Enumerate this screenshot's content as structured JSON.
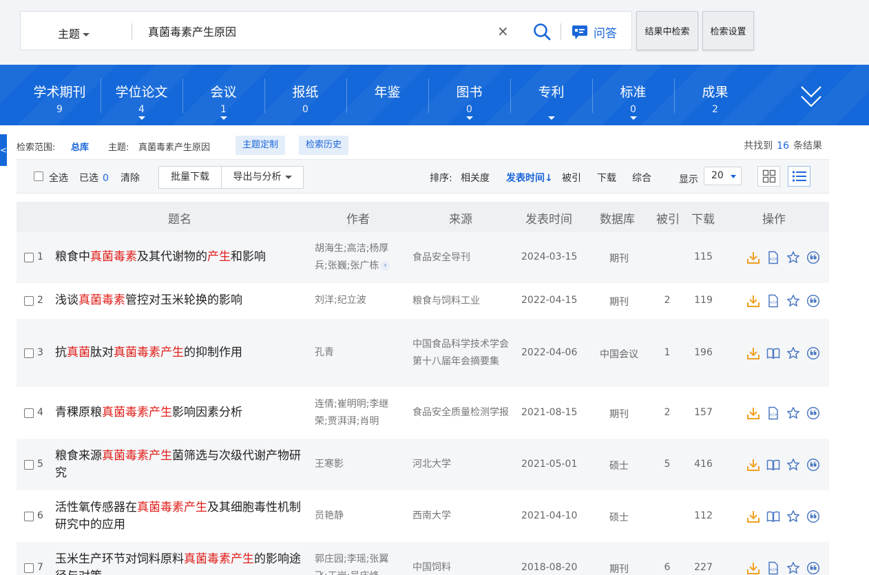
{
  "search": {
    "field": "主题",
    "query": "真菌毒素产生原因",
    "clear_glyph": "×",
    "qa_label": "问答",
    "in_results_label": "结果中检索",
    "settings_label": "检索设置"
  },
  "categories": [
    {
      "name": "学术期刊",
      "count": "9",
      "tri": false
    },
    {
      "name": "学位论文",
      "count": "4",
      "tri": true
    },
    {
      "name": "会议",
      "count": "1",
      "tri": true
    },
    {
      "name": "报纸",
      "count": "0",
      "tri": false
    },
    {
      "name": "年鉴",
      "count": "",
      "tri": false
    },
    {
      "name": "图书",
      "count": "0",
      "tri": true
    },
    {
      "name": "专利",
      "count": "",
      "tri": true
    },
    {
      "name": "标准",
      "count": "0",
      "tri": true
    },
    {
      "name": "成果",
      "count": "2",
      "tri": false
    }
  ],
  "left_tab": "<",
  "scope": {
    "label": "检索范围:",
    "scope_value": "总库",
    "topic_label": "主题:",
    "topic_value": "真菌毒素产生原因",
    "custom_label": "主题定制",
    "history_label": "检索历史",
    "found_prefix": "共找到",
    "found_count": "16",
    "found_suffix": "条结果"
  },
  "toolbar": {
    "select_all": "全选",
    "selected_label": "已选",
    "selected_count": "0",
    "clear": "清除",
    "batch_download": "批量下载",
    "export": "导出与分析",
    "sort_label": "排序:",
    "sort_options": [
      "相关度",
      "发表时间",
      "被引",
      "下载",
      "综合"
    ],
    "sort_active_arrow": "↓",
    "display_label": "显示",
    "display_value": "20"
  },
  "table_headers": [
    "题名",
    "作者",
    "来源",
    "发表时间",
    "数据库",
    "被引",
    "下载",
    "操作"
  ],
  "rows": [
    {
      "idx": "1",
      "title": [
        [
          "粮食中",
          0
        ],
        [
          "真菌毒素",
          1
        ],
        [
          "及其代谢物的",
          0
        ],
        [
          "产生",
          1
        ],
        [
          "和影响",
          0
        ]
      ],
      "author": "胡海生;高洁;杨厚兵;张巍;张广栋",
      "author_more": true,
      "source": "食品安全导刊",
      "date": "2024-03-15",
      "db": "期刊",
      "cite": "",
      "download": "115",
      "read_icon": "html-icon"
    },
    {
      "idx": "2",
      "title": [
        [
          "浅谈",
          0
        ],
        [
          "真菌毒素",
          1
        ],
        [
          "管控对玉米轮换的影响",
          0
        ]
      ],
      "author": "刘洋;纪立波",
      "author_more": false,
      "source": "粮食与饲料工业",
      "date": "2022-04-15",
      "db": "期刊",
      "cite": "2",
      "download": "119",
      "read_icon": "html-icon"
    },
    {
      "idx": "3",
      "title": [
        [
          "抗",
          0
        ],
        [
          "真菌",
          1
        ],
        [
          "肽对",
          0
        ],
        [
          "真菌毒素产生",
          1
        ],
        [
          "的抑制作用",
          0
        ]
      ],
      "author": "孔青",
      "author_more": false,
      "source": "中国食品科学技术学会第十八届年会摘要集",
      "date": "2022-04-06",
      "db": "中国会议",
      "cite": "1",
      "download": "196",
      "read_icon": "book-icon"
    },
    {
      "idx": "4",
      "title": [
        [
          "青稞原粮",
          0
        ],
        [
          "真菌毒素产生",
          1
        ],
        [
          "影响因素分析",
          0
        ]
      ],
      "author": "连倩;崔明明;李继荣;贾湃湃;肖明",
      "author_more": false,
      "source": "食品安全质量检测学报",
      "date": "2021-08-15",
      "db": "期刊",
      "cite": "2",
      "download": "157",
      "read_icon": "html-icon"
    },
    {
      "idx": "5",
      "title": [
        [
          "粮食来源",
          0
        ],
        [
          "真菌毒素产生",
          1
        ],
        [
          "菌筛选与次级代谢产物研究",
          0
        ]
      ],
      "author": "王寒影",
      "author_more": false,
      "source": "河北大学",
      "date": "2021-05-01",
      "db": "硕士",
      "cite": "5",
      "download": "416",
      "read_icon": "book-icon"
    },
    {
      "idx": "6",
      "title": [
        [
          "活性氧传感器在",
          0
        ],
        [
          "真菌毒素产生",
          1
        ],
        [
          "及其细胞毒性机制研究中的应用",
          0
        ]
      ],
      "author": "员艳静",
      "author_more": false,
      "source": "西南大学",
      "date": "2021-04-10",
      "db": "硕士",
      "cite": "",
      "download": "112",
      "read_icon": "book-icon"
    },
    {
      "idx": "7",
      "title": [
        [
          "玉米生产环节对饲料原料",
          0
        ],
        [
          "真菌毒素产生",
          1
        ],
        [
          "的影响途径与对策",
          0
        ]
      ],
      "author": "郭庄园;李瑶;张翼飞;王岩;吴庆峰",
      "author_more": false,
      "source": "中国饲料",
      "date": "2018-08-20",
      "db": "期刊",
      "cite": "6",
      "download": "227",
      "read_icon": "html-icon"
    }
  ],
  "icons": {
    "download": "download-icon",
    "favorite": "star-icon",
    "quote": "quote-icon",
    "view_grid": "grid-view-icon",
    "view_list": "list-view-icon",
    "expand": "double-chevron-down-icon"
  },
  "colors": {
    "accent": "#1a66d9",
    "band": "#1468d9",
    "highlight": "#e0201b",
    "download_icon": "#f0a020"
  }
}
